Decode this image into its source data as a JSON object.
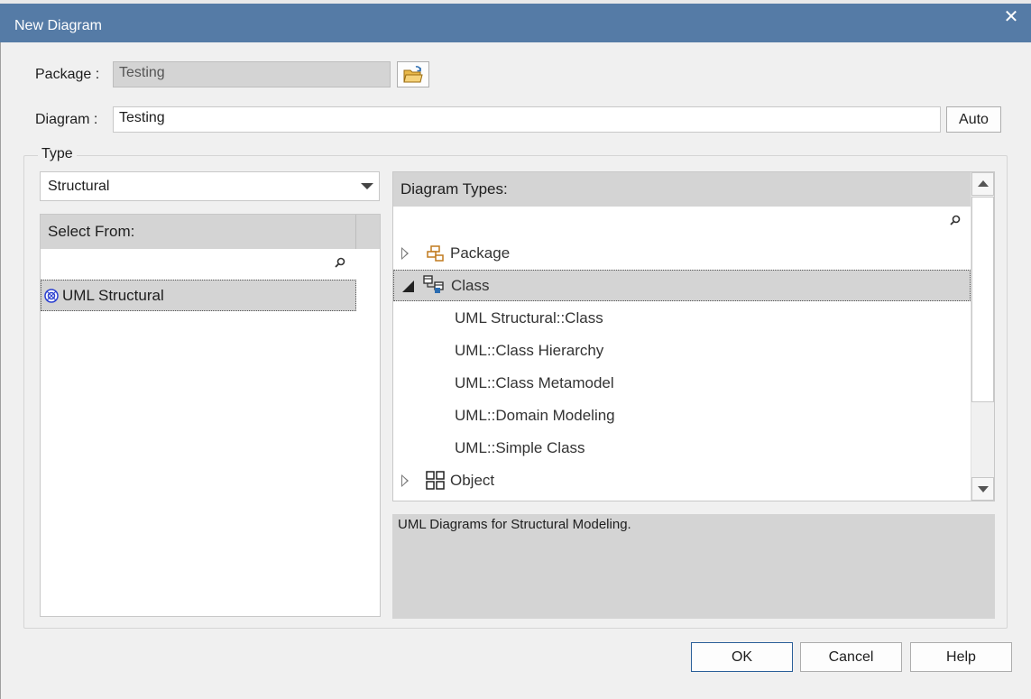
{
  "window": {
    "title": "New Diagram",
    "close_icon": "close-icon"
  },
  "package": {
    "label": "Package :",
    "value": "Testing",
    "browse_icon": "folder-open-icon"
  },
  "diagram": {
    "label": "Diagram :",
    "value": "Testing",
    "auto_label": "Auto"
  },
  "type_group": {
    "legend": "Type",
    "selected": "Structural"
  },
  "select_from": {
    "header": "Select From:",
    "items": [
      {
        "label": "UML Structural",
        "icon": "uml-structural-icon",
        "selected": true
      }
    ]
  },
  "diagram_types": {
    "header": "Diagram Types:",
    "tree": [
      {
        "label": "Package",
        "icon": "package-icon",
        "expanded": false
      },
      {
        "label": "Class",
        "icon": "class-icon",
        "expanded": true,
        "selected": true,
        "children": [
          "UML Structural::Class",
          "UML::Class Hierarchy",
          "UML::Class Metamodel",
          "UML::Domain Modeling",
          "UML::Simple Class"
        ]
      },
      {
        "label": "Object",
        "icon": "object-icon",
        "expanded": false
      }
    ]
  },
  "description": "UML Diagrams for Structural Modeling.",
  "buttons": {
    "ok": "OK",
    "cancel": "Cancel",
    "help": "Help"
  },
  "colors": {
    "titlebar": "#557ba6",
    "selection": "#d4d4d4",
    "dialog_bg": "#f0f0f0",
    "package_icon": "#c07a1e"
  }
}
